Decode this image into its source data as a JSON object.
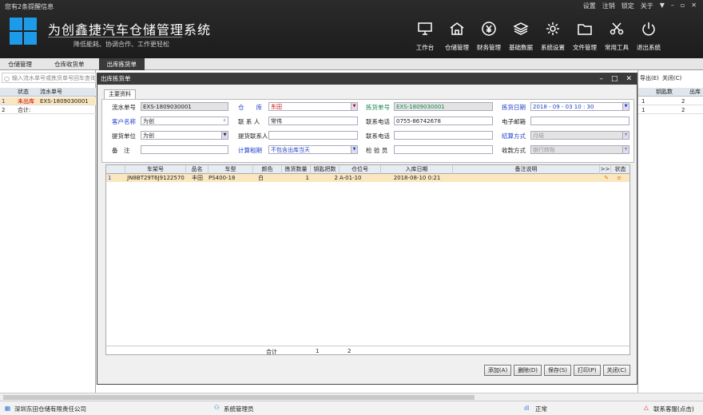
{
  "topbar": {
    "notice": "您有2条提醒信息",
    "sysmenu": [
      "设置",
      "注销",
      "锁定",
      "关于"
    ],
    "title": "为创鑫捷汽车仓储管理系统",
    "slogan": "降低能耗、协调合作、工作更轻松",
    "tools": [
      {
        "label": "工作台",
        "icon": "monitor-icon"
      },
      {
        "label": "仓储管理",
        "icon": "warehouse-icon"
      },
      {
        "label": "财务管理",
        "icon": "yuan-icon"
      },
      {
        "label": "基础数据",
        "icon": "layers-icon"
      },
      {
        "label": "系统设置",
        "icon": "gear-icon"
      },
      {
        "label": "文件管理",
        "icon": "folder-icon"
      },
      {
        "label": "常用工具",
        "icon": "scissors-icon"
      },
      {
        "label": "退出系统",
        "icon": "power-icon"
      }
    ]
  },
  "tabs": [
    "仓储管理",
    "仓库收货单",
    "出库拣货单"
  ],
  "active_tab": 2,
  "left": {
    "search_placeholder": "输入流水单号或拣货单号回车查询",
    "headers": [
      "状态",
      "流水单号"
    ],
    "rows": [
      {
        "idx": "1",
        "status": "未出库",
        "serial": "EXS-1809030001"
      },
      {
        "idx": "2",
        "status": "合计:",
        "serial": ""
      }
    ]
  },
  "right": {
    "export": "导出(E)",
    "close": "关闭(C)",
    "headers": [
      "钥匙数",
      "出库"
    ],
    "rows": [
      [
        "1",
        "2"
      ],
      [
        "1",
        "2"
      ]
    ]
  },
  "dialog": {
    "title": "出库拣货单",
    "subtab": "主要资料",
    "form": {
      "serial_label": "流水单号",
      "serial": "EXS-1809030001",
      "warehouse_label": "仓　　库",
      "warehouse": "东田",
      "pick_no_label": "拣货单号",
      "pick_no": "EXS-1809030001",
      "pick_date_label": "拣货日期",
      "pick_date": "2018 - 09 - 03  10 : 30",
      "customer_label": "客户名称",
      "customer": "为创",
      "contact_label": "联 系 人",
      "contact": "常伟",
      "phone_label": "联系电话",
      "phone": "0755-86742678",
      "email_label": "电子邮箱",
      "email": "",
      "pick_unit_label": "提货单位",
      "pick_unit": "为创",
      "pick_contact_label": "提货联系人",
      "pick_contact": "",
      "phone2_label": "联系电话",
      "phone2": "",
      "settle_label": "结算方式",
      "settle": "月结",
      "remark_label": "备　注",
      "remark": "",
      "rent_label": "计算租期",
      "rent": "不包含出库当天",
      "inspector_label": "检 验 员",
      "inspector": "",
      "pay_label": "收款方式",
      "pay": "银行转账"
    },
    "grid": {
      "headers": [
        "车架号",
        "品名",
        "车型",
        "颜色",
        "拣货数量",
        "钥匙把数",
        "仓位号",
        "入库日期",
        "备注说明",
        ">>",
        "状态"
      ],
      "rows": [
        {
          "idx": "1",
          "vin": "JN8BT29T6J9122570",
          "name": "丰田",
          "model": "PS400-18",
          "color": "白",
          "qty": "1",
          "keys": "2",
          "loc": "A-01-10",
          "date": "2018-08-10 0:21",
          "note": ""
        }
      ],
      "footer": {
        "label": "合计",
        "qty": "1",
        "keys": "2"
      }
    },
    "buttons": [
      "添加(A)",
      "删除(D)",
      "保存(S)",
      "打印(P)",
      "关闭(C)"
    ]
  },
  "status": {
    "company": "深圳东田仓储有限责任公司",
    "user": "系统管理员",
    "net": "正常",
    "support": "联系客服(点击)"
  }
}
